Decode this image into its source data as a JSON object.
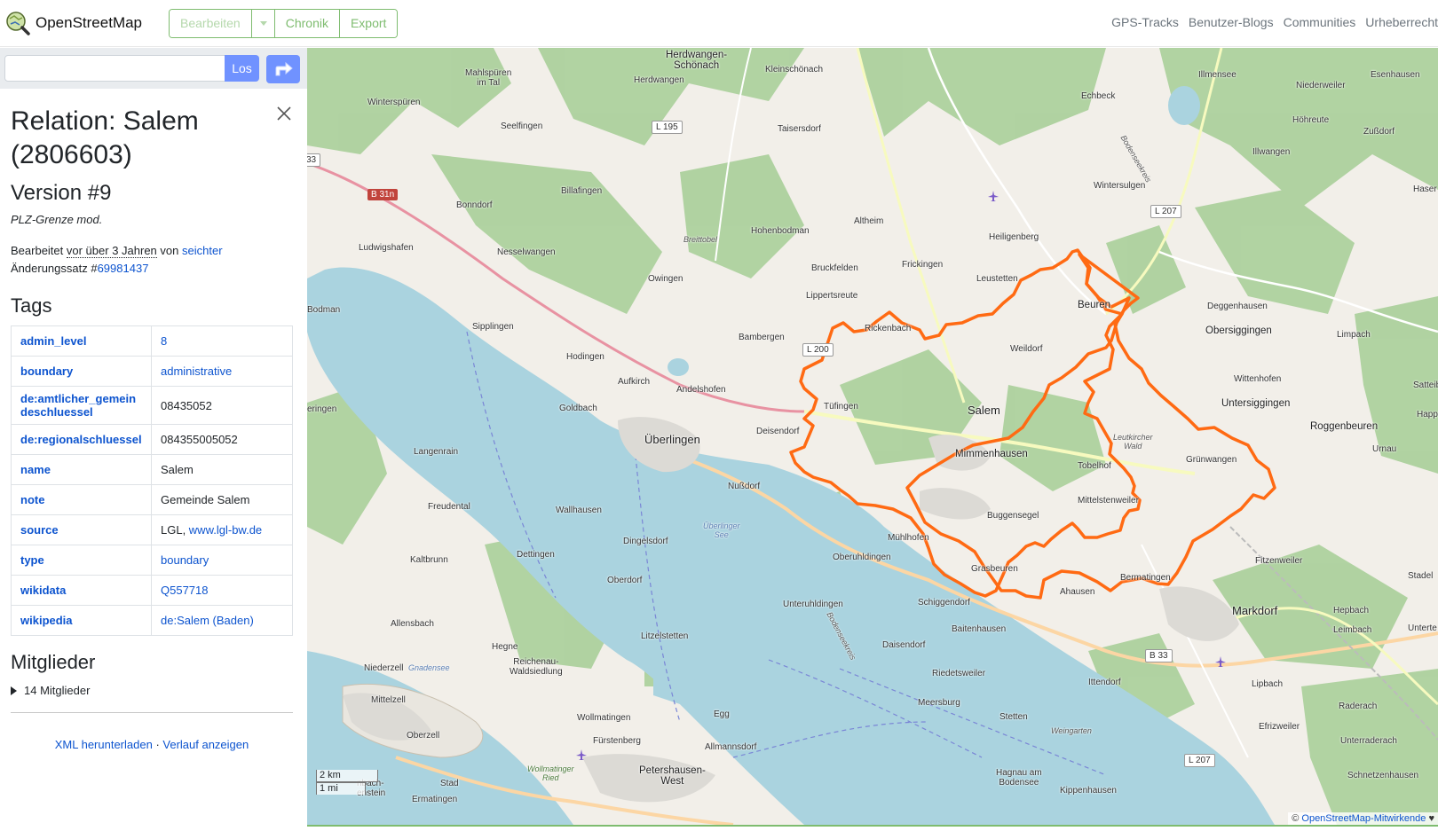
{
  "header": {
    "brand": "OpenStreetMap",
    "edit_label": "Bearbeiten",
    "history_label": "Chronik",
    "export_label": "Export",
    "nav": [
      "GPS-Tracks",
      "Benutzer-Blogs",
      "Communities",
      "Urheberrecht"
    ]
  },
  "search": {
    "value": "",
    "go_label": "Los"
  },
  "panel": {
    "title": "Relation: Salem (2806603)",
    "version": "Version #9",
    "comment": "PLZ-Grenze mod.",
    "edited_prefix": "Bearbeitet",
    "edited_when": "vor über 3 Jahren",
    "edited_by_prefix": "von",
    "edited_by": "seichter",
    "changeset_prefix": "Änderungssatz #",
    "changeset": "69981437",
    "tags_heading": "Tags",
    "tags": [
      {
        "key": "admin_level",
        "value": "8",
        "link": true
      },
      {
        "key": "boundary",
        "value": "administrative",
        "link": true
      },
      {
        "key": "de:amtlicher_gemeindeschluessel",
        "value": "08435052",
        "link": false
      },
      {
        "key": "de:regionalschluessel",
        "value": "084355005052",
        "link": false
      },
      {
        "key": "name",
        "value": "Salem",
        "link": false
      },
      {
        "key": "note",
        "value": "Gemeinde Salem",
        "link": false
      },
      {
        "key": "source",
        "value": "LGL, ",
        "value_link": "www.lgl-bw.de",
        "link": false
      },
      {
        "key": "type",
        "value": "boundary",
        "link": true
      },
      {
        "key": "wikidata",
        "value": "Q557718",
        "link": true
      },
      {
        "key": "wikipedia",
        "value": "de:Salem (Baden)",
        "link": true
      }
    ],
    "members_heading": "Mitglieder",
    "members_toggle": "14 Mitglieder",
    "download_xml": "XML herunterladen",
    "separator": " · ",
    "view_history": "Verlauf anzeigen"
  },
  "map": {
    "boundary_color": "#ff6a13",
    "scale_km": "2 km",
    "scale_mi": "1 mi",
    "attribution_prefix": "© ",
    "attribution_link": "OpenStreetMap-Mitwirkende",
    "attribution_suffix": " ♥",
    "places": {
      "herdwangen_schoenach": "Herdwangen-\nSchönach",
      "herdwangen": "Herdwangen",
      "kleinschoenach": "Kleinschönach",
      "mahlspueren": "Mahlspüren\nim Tal",
      "winterspueren": "Winterspüren",
      "seelfingen": "Seelfingen",
      "taisersdorf": "Taisersdorf",
      "echbeck": "Echbeck",
      "illmensee": "Illmensee",
      "niederweiler": "Niederweiler",
      "esenhausen": "Esenhausen",
      "hoehreute": "Höhreute",
      "zussdorf": "Zußdorf",
      "illwangen": "Illwangen",
      "haser": "Haser",
      "wintersulgen": "Wintersulgen",
      "billafingen": "Billafingen",
      "bonndorf": "Bonndorf",
      "breittobel": "Breittobel",
      "hohenbodman": "Hohenbodman",
      "altheim": "Altheim",
      "heiligenberg": "Heiligenberg",
      "ludwigshafen": "Ludwigshafen",
      "nesselwangen": "Nesselwangen",
      "owingen": "Owingen",
      "bruckfelden": "Bruckfelden",
      "frickingen": "Frickingen",
      "leustetten": "Leustetten",
      "beuren": "Beuren",
      "deggenhausen": "Deggenhausen",
      "bodman": "Bodman",
      "lippertsreute": "Lippertsreute",
      "obersiggingen": "Obersiggingen",
      "sipplingen": "Sipplingen",
      "rickenbach": "Rickenbach",
      "limpach": "Limpach",
      "bambergen": "Bambergen",
      "weildorf": "Weildorf",
      "hodingen": "Hodingen",
      "wittenhofen": "Wittenhofen",
      "satteibach": "Satteib",
      "aufkirch": "Aufkirch",
      "andelshofen": "Andelshofen",
      "untersiggingen": "Untersiggingen",
      "happenweiler": "Happenwe",
      "eringen": "eringen",
      "goldbach": "Goldbach",
      "tuefingen": "Tüfingen",
      "salem": "Salem",
      "roggenbeuren": "Roggenbeuren",
      "ueberlingen": "Überlingen",
      "deisendorf": "Deisendorf",
      "leutkircher_wald": "Leutkircher\nWald",
      "urnau": "Urnau",
      "langenrain": "Langenrain",
      "mimmenhausen": "Mimmenhausen",
      "tobelhof": "Tobelhof",
      "gruenwangen": "Grünwangen",
      "nussdorf": "Nußdorf",
      "freudental": "Freudental",
      "mittelstenweiler": "Mittelstenweiler",
      "wallhausen": "Wallhausen",
      "buggensegel": "Buggensegel",
      "ueberlinger_see": "Überlinger\nSee",
      "dingelsdorf": "Dingelsdorf",
      "muehlhofen": "Mühlhofen",
      "kaltbrunn": "Kaltbrunn",
      "dettingen": "Dettingen",
      "oberuhldingen": "Oberuhldingen",
      "fitzenweiler": "Fitzenweiler",
      "grasbeuren": "Grasbeuren",
      "bermatingen": "Bermatingen",
      "stadel": "Stadel",
      "oberdorf": "Oberdorf",
      "ahausen": "Ahausen",
      "unteruhldingen": "Unteruhldingen",
      "schiggendorf": "Schiggendorf",
      "markdorf": "Markdorf",
      "hepbach": "Hepbach",
      "allensbach": "Allensbach",
      "baitenhausen": "Baitenhausen",
      "leimbach": "Leimbach",
      "litzelstetten": "Litzelstetten",
      "unterteuringen": "Unterte",
      "hegne": "Hegne",
      "daisendorf": "Daisendorf",
      "niederzell": "Niederzell",
      "gnadensee": "Gnadensee",
      "reichenau": "Reichenau-\nWaldsiedlung",
      "riedetsweiler": "Riedetsweiler",
      "ittendorf": "Ittendorf",
      "lipbach": "Lipbach",
      "mittelzell": "Mittelzell",
      "meersburg": "Meersburg",
      "raderach": "Raderach",
      "wollmatingen": "Wollmatingen",
      "egg": "Egg",
      "stetten": "Stetten",
      "efrizweiler": "Efrizweiler",
      "oberzell": "Oberzell",
      "weingarten": "Weingarten",
      "unterraderach": "Unterraderach",
      "fuerstenberg": "Fürstenberg",
      "allmannsdorf": "Allmannsdorf",
      "schnetzenhausen": "Schnetzenhausen",
      "wollmatinger_ried": "Wollmatinger\nRied",
      "petershausen": "Petershausen-\nWest",
      "hagnau": "Hagnau am\nBodensee",
      "kippenhausen": "Kippenhausen",
      "stad": "Stad",
      "bach": "nbach-\nenstein",
      "ermatingen": "Ermatingen",
      "bodenseekreis": "Bodenseekreis",
      "bodenseekreis2": "Bodenseekreis"
    },
    "roads": {
      "b31n": "B 31n",
      "l195": "L 195",
      "l207": "L 207",
      "l200": "L 200",
      "b33": "B 33",
      "l207b": "L 207",
      "b33_edge": "33"
    }
  }
}
